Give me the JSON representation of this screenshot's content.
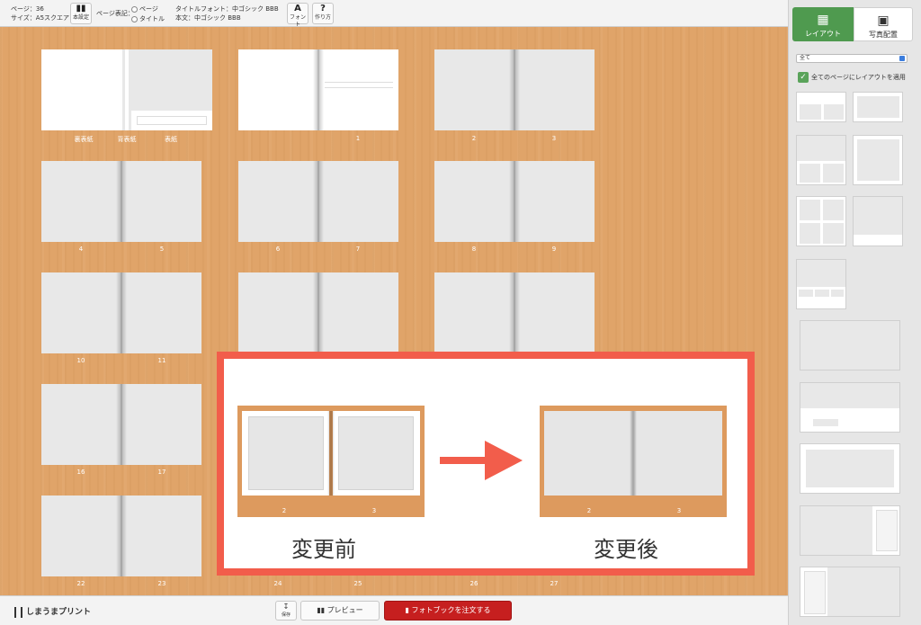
{
  "toolbar": {
    "pages_line": "ページ：36",
    "size_line": "サイズ：A5スクエア",
    "book_settings": "本設定",
    "page_notation_label": "ページ表記：",
    "opt_page": "ページ",
    "opt_title": "タイトル",
    "title_font_line": "タイトルフォント：中ゴシック BBB",
    "body_font_line": "本文：中ゴシック BBB",
    "font_button": "フォント",
    "font_icon_glyph": "A",
    "help_button": "作り方",
    "help_icon_glyph": "?"
  },
  "canvas": {
    "cover_labels": [
      "裏表紙",
      "背表紙",
      "表紙"
    ],
    "spread_labels": [
      [
        "1"
      ],
      [
        "2",
        "3"
      ],
      [
        "4",
        "5"
      ],
      [
        "6",
        "7"
      ],
      [
        "8",
        "9"
      ],
      [
        "10",
        "11"
      ],
      [
        "16",
        "17"
      ],
      [
        "22",
        "23"
      ],
      [
        "24",
        "25"
      ],
      [
        "26",
        "27"
      ]
    ]
  },
  "overlay": {
    "before_label": "変更前",
    "after_label": "変更後",
    "before_pages": [
      "2",
      "3"
    ],
    "after_pages": [
      "2",
      "3"
    ],
    "accent_color": "#f25d4b"
  },
  "right_panel": {
    "tab_layout": "レイアウト",
    "tab_photo": "写真配置",
    "filter_value": "全て",
    "apply_all": "全てのページにレイアウトを適用",
    "accent_color": "#4f9a4f"
  },
  "bottom": {
    "logo": "しまうまプリント",
    "save": "保存",
    "preview": "プレビュー",
    "order": "フォトブックを注文する",
    "order_color": "#c61f1f"
  }
}
